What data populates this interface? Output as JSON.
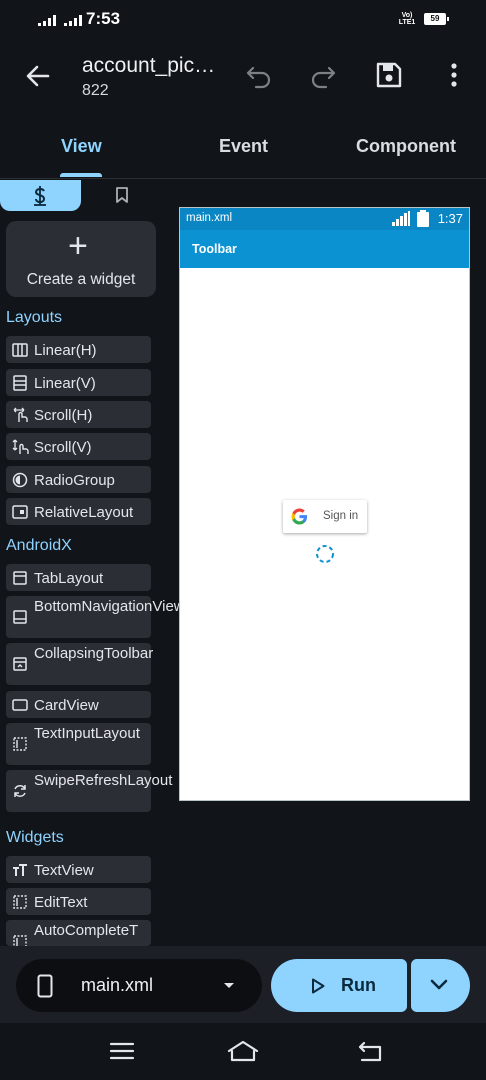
{
  "status_bar": {
    "time": "7:53",
    "network_tag": "Vo) LTE1",
    "battery": "59"
  },
  "app_bar": {
    "project_name": "account_pic…",
    "project_id": "822"
  },
  "tabs": [
    {
      "label": "View",
      "active": true
    },
    {
      "label": "Event",
      "active": false
    },
    {
      "label": "Component",
      "active": false
    }
  ],
  "palette": {
    "create_widget_label": "Create a widget",
    "sections": {
      "layouts": "Layouts",
      "androidx": "AndroidX",
      "widgets": "Widgets"
    },
    "layouts": [
      "Linear(H)",
      "Linear(V)",
      "Scroll(H)",
      "Scroll(V)",
      "RadioGroup",
      "RelativeLayout"
    ],
    "androidx": [
      "TabLayout",
      "BottomNavigationView",
      "CollapsingToolbar",
      "CardView",
      "TextInputLayout",
      "SwipeRefreshLayout"
    ],
    "widgets": [
      "TextView",
      "EditText",
      "AutoCompleteT"
    ]
  },
  "preview": {
    "file_name": "main.xml",
    "time": "1:37",
    "toolbar_title": "Toolbar",
    "signin_label": "Sign in"
  },
  "bottom_bar": {
    "file_selector": "main.xml",
    "run_label": "Run"
  },
  "colors": {
    "accent": "#8fd3ff",
    "background": "#111418",
    "item_bg": "#2b2f35",
    "preview_status": "#0a86c4",
    "preview_toolbar": "#0a92d2"
  }
}
